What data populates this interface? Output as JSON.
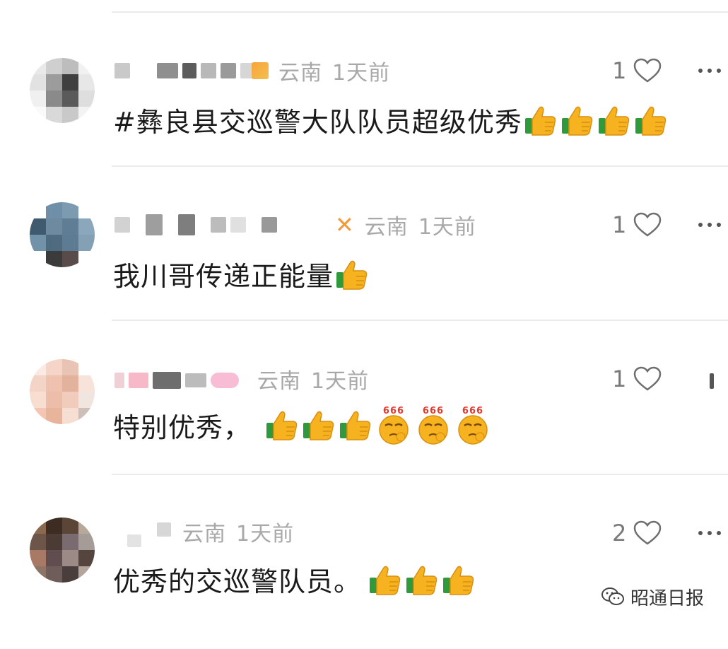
{
  "comments": [
    {
      "location": "云南",
      "time": "1天前",
      "text": "#彝良县交巡警大队队员超级优秀",
      "likes": "1",
      "emojis": [
        "thumbs-up",
        "thumbs-up",
        "thumbs-up",
        "thumbs-up"
      ]
    },
    {
      "location": "云南",
      "time": "1天前",
      "text": "我川哥传递正能量",
      "likes": "1",
      "emojis": [
        "thumbs-up"
      ]
    },
    {
      "location": "云南",
      "time": "1天前",
      "text": "特别优秀，",
      "likes": "1",
      "emojis": [
        "thumbs-up",
        "thumbs-up",
        "thumbs-up",
        "666-face",
        "666-face",
        "666-face"
      ]
    },
    {
      "location": "云南",
      "time": "1天前",
      "text": "优秀的交巡警队员。",
      "likes": "2",
      "emojis": [
        "thumbs-up",
        "thumbs-up",
        "thumbs-up"
      ]
    }
  ],
  "emoji_666_label": "666",
  "watermark": {
    "icon": "wechat-icon",
    "text": "昭通日报"
  },
  "colors": {
    "meta_gray": "#a8a8a8",
    "text": "#1a1a1a",
    "divider": "#ebebeb",
    "thumb_yellow": "#f6b21f",
    "thumb_cuff": "#2f9a3c"
  }
}
